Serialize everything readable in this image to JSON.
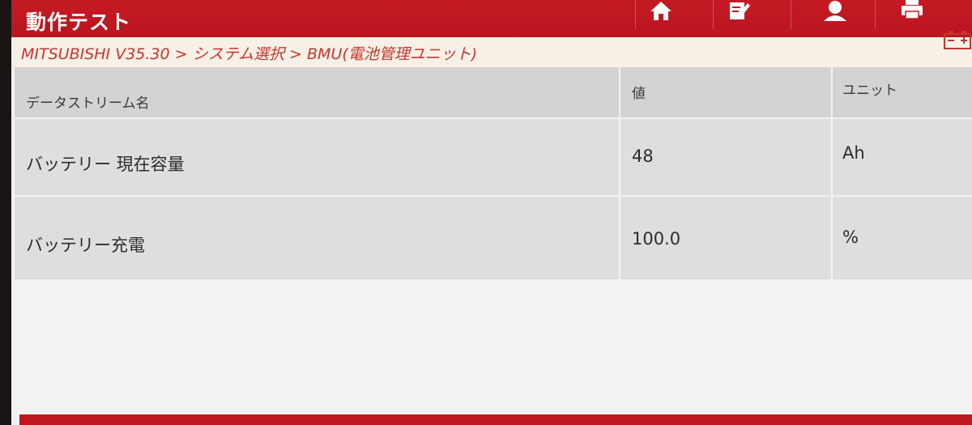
{
  "header": {
    "title": "動作テスト",
    "toolbar": [
      {
        "icon": "home-icon"
      },
      {
        "icon": "edit-icon"
      },
      {
        "icon": "user-icon"
      },
      {
        "icon": "print-icon"
      }
    ],
    "accent_color": "#c51a24"
  },
  "breadcrumb": {
    "text": "MITSUBISHI V35.30 > システム選択 > BMU(電池管理ユニット)",
    "color": "#c2372e"
  },
  "status_icon": "battery-icon",
  "table": {
    "columns": [
      "データストリーム名",
      "値",
      "ユニット"
    ],
    "rows": [
      {
        "name": "バッテリー 現在容量",
        "value": "48",
        "unit": "Ah"
      },
      {
        "name": "バッテリー充電",
        "value": "100.0",
        "unit": "%"
      }
    ]
  }
}
